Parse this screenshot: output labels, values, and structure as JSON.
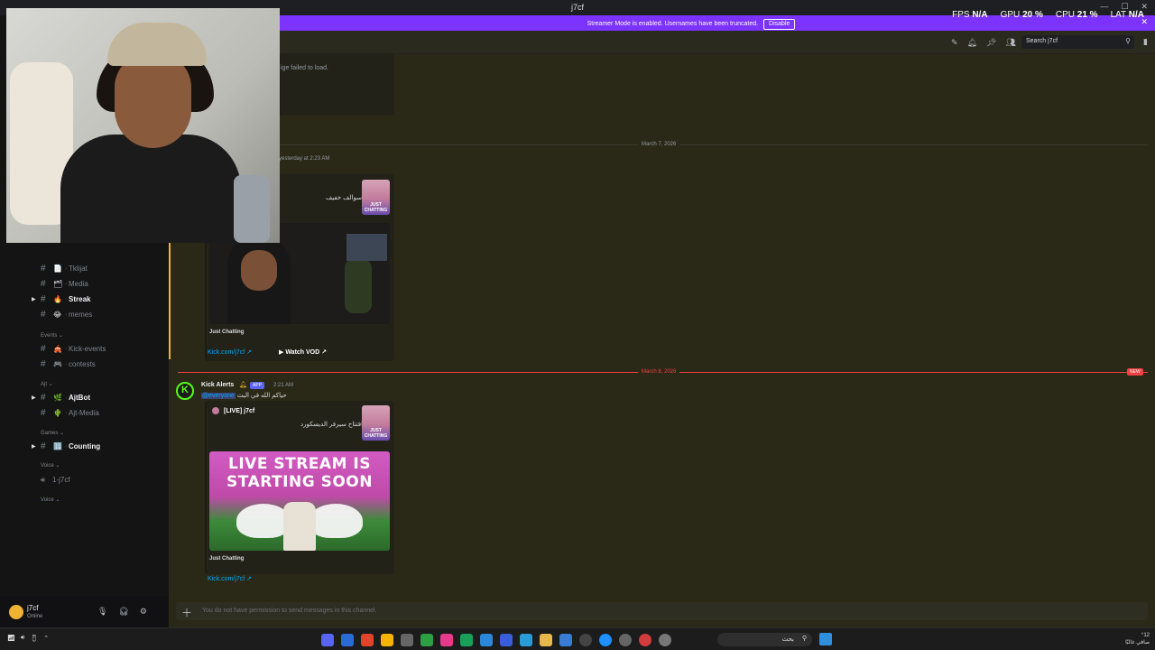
{
  "window": {
    "title": "j7cf"
  },
  "banner": {
    "text": "Streamer Mode is enabled. Usernames have been truncated.",
    "button": "Disable"
  },
  "perf": [
    {
      "label": "FPS",
      "value": "N/A"
    },
    {
      "label": "GPU",
      "value": "20 %"
    },
    {
      "label": "CPU",
      "value": "21 %"
    },
    {
      "label": "LAT",
      "value": "N/A"
    }
  ],
  "header": {
    "search_placeholder": "Search j7cf"
  },
  "sidebar": {
    "channels": [
      {
        "name": "Tklijat",
        "emoji": "📄",
        "bold": false,
        "caret": false
      },
      {
        "name": "Media",
        "emoji": "🗂",
        "bold": false,
        "caret": false
      },
      {
        "name": "Streak",
        "emoji": "🔥",
        "bold": true,
        "caret": true
      },
      {
        "name": "memes",
        "emoji": "😂",
        "bold": false,
        "caret": false
      }
    ],
    "category_events": "Events",
    "events_channels": [
      {
        "name": "Kick-events",
        "emoji": "🎪",
        "bold": false,
        "caret": false
      },
      {
        "name": "contests",
        "emoji": "🎮",
        "bold": false,
        "caret": false
      }
    ],
    "category_ajt": "Ajt",
    "ajt_channels": [
      {
        "name": "AjtBot",
        "emoji": "🌿",
        "bold": true,
        "caret": true
      },
      {
        "name": "Ajt-Media",
        "emoji": "🌵",
        "bold": false,
        "caret": false
      }
    ],
    "category_games": "Games",
    "games_channels": [
      {
        "name": "Counting",
        "emoji": "🔢",
        "bold": true,
        "caret": true
      }
    ],
    "category_voice1": "Voice",
    "voice_channel": "1-j7cf",
    "category_voice2": "Voice"
  },
  "user": {
    "name": "j7cf",
    "status": "Online"
  },
  "messages": {
    "img_failed": "ige failed to load.",
    "date1": "March 7, 2026",
    "yesterday": "yesterday at 2:23 AM",
    "arabic1": "سوالف خفيف",
    "card1_game": "Just Chatting",
    "card1_link": "Kick.com/j7cf",
    "card1_vod": "Watch VOD",
    "date2": "March 8, 2026",
    "new_badge": "NEW",
    "bot_name": "Kick Alerts",
    "bot_tag": "APP",
    "bot_time": "2:21 AM",
    "bot_mention": "@everyone",
    "bot_text": "حياكم الله في البث",
    "live_title": "[LIVE] j7cf",
    "live_desc": "افتتاح سيرفر الديسكورد",
    "thumb_cap": "JUST CHATTING",
    "live_banner_l1": "LIVE STREAM IS",
    "live_banner_l2": "STARTING SOON",
    "card2_game": "Just Chatting",
    "card2_link": "Kick.com/j7cf"
  },
  "composer": {
    "placeholder": "You do not have permission to send messages in this channel."
  },
  "taskbar": {
    "search": "بحث",
    "clock_line1": "°12",
    "clock_line2": "صافي غالبًا"
  }
}
